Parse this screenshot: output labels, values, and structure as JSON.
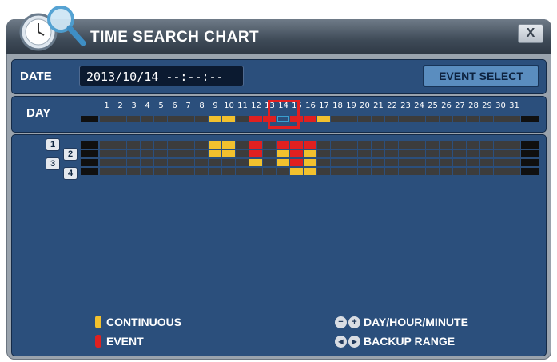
{
  "window": {
    "title": "TIME SEARCH CHART",
    "close_label": "X"
  },
  "date_bar": {
    "date_label": "DATE",
    "date_value": "2013/10/14 --:--:--",
    "event_select_label": "EVENT SELECT"
  },
  "day_bar": {
    "day_label": "DAY",
    "days": [
      "1",
      "2",
      "3",
      "4",
      "5",
      "6",
      "7",
      "8",
      "9",
      "10",
      "11",
      "12",
      "13",
      "14",
      "15",
      "16",
      "17",
      "18",
      "19",
      "20",
      "21",
      "22",
      "23",
      "24",
      "25",
      "26",
      "27",
      "28",
      "29",
      "30",
      "31"
    ],
    "selected_day": "14",
    "day_status": [
      "none",
      "none",
      "none",
      "none",
      "none",
      "none",
      "none",
      "none",
      "continuous",
      "continuous",
      "none",
      "event",
      "event",
      "selected",
      "event",
      "event",
      "continuous",
      "none",
      "none",
      "none",
      "none",
      "none",
      "none",
      "none",
      "none",
      "none",
      "none",
      "none",
      "none",
      "none",
      "none"
    ]
  },
  "channels": [
    {
      "label": "1",
      "status": [
        "none",
        "none",
        "none",
        "none",
        "none",
        "none",
        "none",
        "none",
        "continuous",
        "continuous",
        "none",
        "event",
        "none",
        "event",
        "event",
        "event",
        "none",
        "none",
        "none",
        "none",
        "none",
        "none",
        "none",
        "none",
        "none",
        "none",
        "none",
        "none",
        "none",
        "none",
        "none"
      ]
    },
    {
      "label": "2",
      "status": [
        "none",
        "none",
        "none",
        "none",
        "none",
        "none",
        "none",
        "none",
        "continuous",
        "continuous",
        "none",
        "event",
        "none",
        "continuous",
        "event",
        "continuous",
        "none",
        "none",
        "none",
        "none",
        "none",
        "none",
        "none",
        "none",
        "none",
        "none",
        "none",
        "none",
        "none",
        "none",
        "none"
      ]
    },
    {
      "label": "3",
      "status": [
        "none",
        "none",
        "none",
        "none",
        "none",
        "none",
        "none",
        "none",
        "none",
        "none",
        "none",
        "continuous",
        "none",
        "continuous",
        "event",
        "continuous",
        "none",
        "none",
        "none",
        "none",
        "none",
        "none",
        "none",
        "none",
        "none",
        "none",
        "none",
        "none",
        "none",
        "none",
        "none"
      ]
    },
    {
      "label": "4",
      "status": [
        "none",
        "none",
        "none",
        "none",
        "none",
        "none",
        "none",
        "none",
        "none",
        "none",
        "none",
        "none",
        "none",
        "none",
        "continuous",
        "continuous",
        "none",
        "none",
        "none",
        "none",
        "none",
        "none",
        "none",
        "none",
        "none",
        "none",
        "none",
        "none",
        "none",
        "none",
        "none"
      ]
    }
  ],
  "legend": {
    "continuous_label": "CONTINUOUS",
    "event_label": "EVENT",
    "day_hour_minute_label": "DAY/HOUR/MINUTE",
    "backup_range_label": "BACKUP RANGE",
    "minus_glyph": "−",
    "plus_glyph": "+",
    "left_glyph": "◀",
    "right_glyph": "▶"
  },
  "colors": {
    "continuous": "#f2c12e",
    "event": "#e02020",
    "empty": "#3c3c3c",
    "selected": "#3a9fd0"
  }
}
